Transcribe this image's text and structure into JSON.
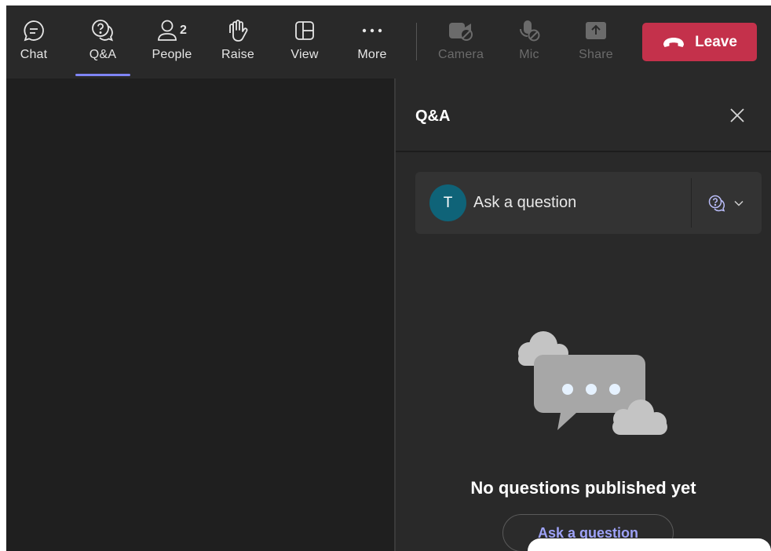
{
  "toolbar": {
    "items": [
      {
        "label": "Chat",
        "icon": "chat-icon"
      },
      {
        "label": "Q&A",
        "icon": "qa-icon"
      },
      {
        "label": "People",
        "icon": "people-icon",
        "count": "2"
      },
      {
        "label": "Raise",
        "icon": "raise-hand-icon"
      },
      {
        "label": "View",
        "icon": "view-grid-icon"
      },
      {
        "label": "More",
        "icon": "more-icon"
      },
      {
        "label": "Camera",
        "icon": "camera-off-icon"
      },
      {
        "label": "Mic",
        "icon": "mic-off-icon"
      },
      {
        "label": "Share",
        "icon": "share-icon"
      }
    ],
    "active_tab": "Q&A",
    "leave_label": "Leave"
  },
  "panel": {
    "title": "Q&A",
    "avatar_initial": "T",
    "ask_placeholder": "Ask a question",
    "empty_message": "No questions published yet",
    "ask_button_label": "Ask a question"
  },
  "colors": {
    "accent": "#7f85f5",
    "leave": "#c4314b",
    "avatar": "#0f6378"
  }
}
